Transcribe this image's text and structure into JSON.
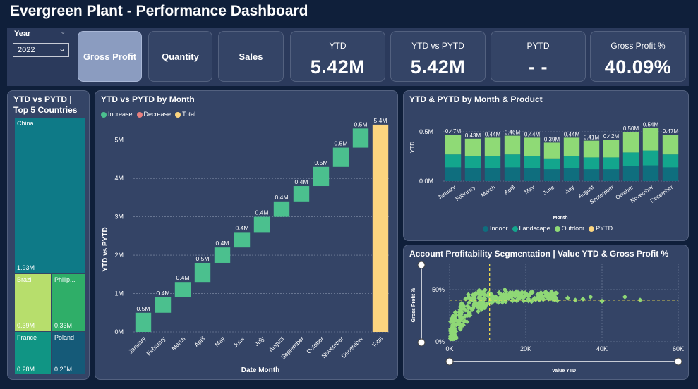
{
  "header": {
    "title": "Evergreen Plant - Performance Dashboard"
  },
  "slicer": {
    "label": "Year",
    "value": "2022"
  },
  "buttons": {
    "gross_profit": "Gross Profit",
    "quantity": "Quantity",
    "sales": "Sales"
  },
  "kpis": [
    {
      "label": "YTD",
      "value": "5.42M"
    },
    {
      "label": "YTD vs PYTD",
      "value": "5.42M"
    },
    {
      "label": "PYTD",
      "value": "- -"
    },
    {
      "label": "Gross Profit %",
      "value": "40.09%"
    }
  ],
  "treemap": {
    "title_line1": "YTD vs PYTD |",
    "title_line2": "Top 5 Countries",
    "items": [
      {
        "name": "China",
        "value": "1.93M",
        "color": "#0e7a87"
      },
      {
        "name": "Brazil",
        "value": "0.39M",
        "color": "#b7de6c"
      },
      {
        "name": "Philip...",
        "value": "0.33M",
        "color": "#2fae68"
      },
      {
        "name": "France",
        "value": "0.28M",
        "color": "#109584"
      },
      {
        "name": "Poland",
        "value": "0.25M",
        "color": "#155a78"
      }
    ]
  },
  "colors": {
    "increase": "#4bc08e",
    "decrease": "#e8807f",
    "total": "#fcd57f",
    "indoor": "#0f6e7e",
    "landscape": "#13a68d",
    "outdoor": "#8fda76",
    "scatter": "#8fd876",
    "bg": "#0f1f3a",
    "panel": "#344466"
  },
  "chart_data": [
    {
      "type": "bar",
      "title": "YTD vs PYTD by Month",
      "subtype": "waterfall",
      "xlabel": "Date Month",
      "ylabel": "YTD vs PYTD",
      "legend": [
        "Increase",
        "Decrease",
        "Total"
      ],
      "categories": [
        "January",
        "February",
        "March",
        "April",
        "May",
        "June",
        "July",
        "August",
        "September",
        "October",
        "November",
        "December",
        "Total"
      ],
      "values": [
        0.5,
        0.4,
        0.4,
        0.5,
        0.4,
        0.4,
        0.4,
        0.4,
        0.4,
        0.5,
        0.5,
        0.5,
        5.4
      ],
      "data_labels": [
        "0.5M",
        "0.4M",
        "0.4M",
        "0.5M",
        "0.4M",
        "0.4M",
        "0.4M",
        "0.4M",
        "0.4M",
        "0.5M",
        "0.5M",
        "0.5M",
        "5.4M"
      ],
      "yticks": [
        "0M",
        "1M",
        "2M",
        "3M",
        "4M",
        "5M"
      ],
      "ylim": [
        0,
        5.6
      ]
    },
    {
      "type": "bar",
      "title": "YTD & PYTD by Month & Product",
      "subtype": "stacked",
      "xlabel": "Month",
      "ylabel": "YTD",
      "categories": [
        "January",
        "February",
        "March",
        "April",
        "May",
        "June",
        "July",
        "August",
        "September",
        "October",
        "November",
        "December"
      ],
      "series": [
        {
          "name": "Indoor",
          "values": [
            0.14,
            0.13,
            0.13,
            0.14,
            0.13,
            0.12,
            0.13,
            0.12,
            0.12,
            0.15,
            0.16,
            0.14
          ]
        },
        {
          "name": "Landscape",
          "values": [
            0.13,
            0.12,
            0.12,
            0.13,
            0.12,
            0.11,
            0.12,
            0.12,
            0.12,
            0.14,
            0.15,
            0.13
          ]
        },
        {
          "name": "Outdoor",
          "values": [
            0.2,
            0.18,
            0.19,
            0.19,
            0.19,
            0.16,
            0.19,
            0.17,
            0.18,
            0.21,
            0.23,
            0.2
          ]
        }
      ],
      "legend": [
        "Indoor",
        "Landscape",
        "Outdoor",
        "PYTD"
      ],
      "data_labels": [
        "0.47M",
        "0.43M",
        "0.44M",
        "0.46M",
        "0.44M",
        "0.39M",
        "0.44M",
        "0.41M",
        "0.42M",
        "0.50M",
        "0.54M",
        "0.47M"
      ],
      "yticks": [
        "0.0M",
        "0.5M"
      ],
      "ylim": [
        0,
        0.6
      ]
    },
    {
      "type": "scatter",
      "title": "Account Profitability Segmentation | Value YTD & Gross Profit %",
      "xlabel": "Value YTD",
      "ylabel": "Gross Profit %",
      "xticks": [
        "0K",
        "20K",
        "40K",
        "60K"
      ],
      "yticks": [
        "0%",
        "50%"
      ],
      "xlim": [
        0,
        60000
      ],
      "ylim": [
        0,
        0.75
      ],
      "avg_x": 10500,
      "avg_y": 0.4
    }
  ]
}
